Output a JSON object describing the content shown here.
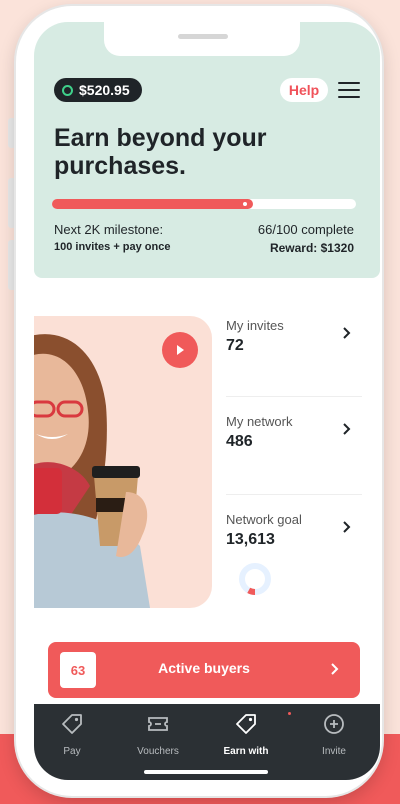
{
  "wallet": {
    "balance": "$520.95"
  },
  "header": {
    "help_label": "Help",
    "headline": "Earn beyond your purchases.",
    "progress": {
      "completed": 66,
      "total": 100,
      "fraction": 0.66
    },
    "milestone_title": "Next 2K milestone:",
    "milestone_requirement": "100 invites + pay once",
    "complete_text": "66/100 complete",
    "reward_text": "Reward: $1320"
  },
  "stats": [
    {
      "label": "My invites",
      "value": "72"
    },
    {
      "label": "My network",
      "value": "486"
    },
    {
      "label": "Network goal",
      "value": "13,613"
    }
  ],
  "network_goal_ring": {
    "fraction": 0.08
  },
  "active_buyers": {
    "count": "63",
    "label": "Active buyers"
  },
  "tabs": [
    {
      "label": "Pay",
      "icon": "tag-icon",
      "active": false
    },
    {
      "label": "Vouchers",
      "icon": "ticket-icon",
      "active": false
    },
    {
      "label": "Earn with",
      "icon": "tag-icon",
      "active": true,
      "notification": true
    },
    {
      "label": "Invite",
      "icon": "plus-circle-icon",
      "active": false
    }
  ],
  "colors": {
    "accent": "#f05a5a",
    "header_bg": "#d7ebe3",
    "tabbar_bg": "#2b3034",
    "photo_card_bg": "#fbe0d6"
  }
}
